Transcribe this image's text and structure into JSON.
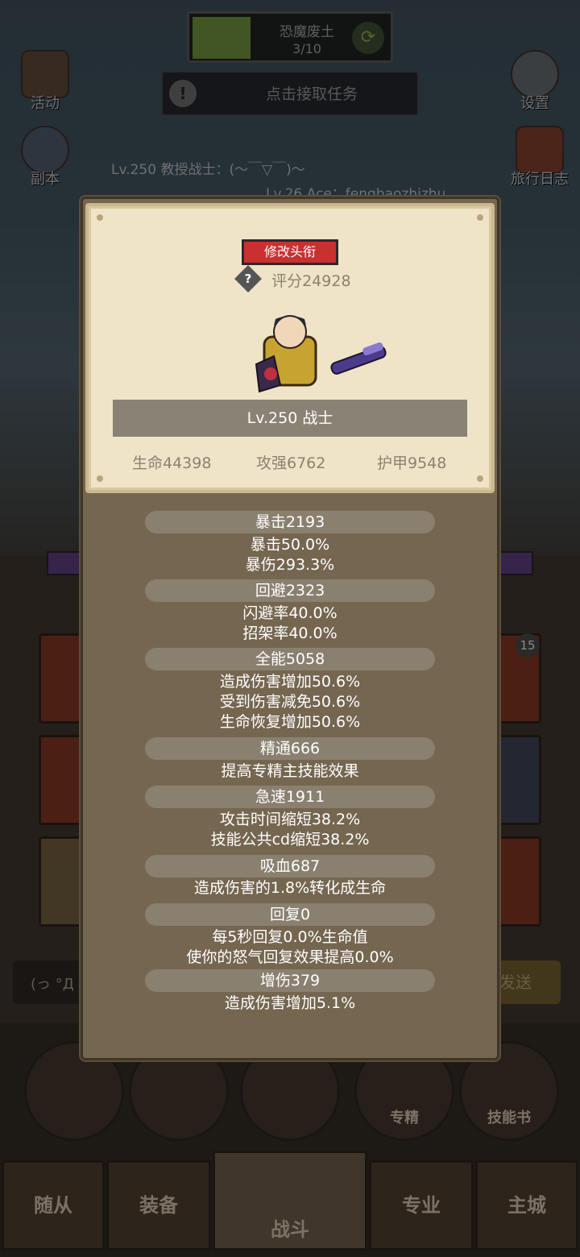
{
  "quest": {
    "name": "恐魔废土",
    "progress": "3/10"
  },
  "task_button": {
    "label": "点击接取任务"
  },
  "side_menu": {
    "activity": "活动",
    "dungeon": "副本",
    "settings": "设置",
    "travel_log": "旅行日志"
  },
  "chat": {
    "line1": "Lv.250 教授战士：(～￣▽￣)～",
    "line2": "Lv.26 Ace：fengbaozhizhu"
  },
  "skill_badge": "15",
  "send": {
    "input_prefix": "(っ °Д °;",
    "button": "发送"
  },
  "round_buttons": {
    "spec": "专精",
    "skill_book": "技能书"
  },
  "bottom_nav": [
    "随从",
    "装备",
    "战斗",
    "专业",
    "主城"
  ],
  "profile": {
    "change_title_button": "修改头衔",
    "score_icon": "?",
    "score": "评分24928",
    "name_bar": "Lv.250 战士",
    "hp": "生命44398",
    "attack": "攻强6762",
    "armor": "护甲9548"
  },
  "stats": [
    {
      "header": "暴击2193",
      "lines": [
        "暴击50.0%",
        "暴伤293.3%"
      ]
    },
    {
      "header": "回避2323",
      "lines": [
        "闪避率40.0%",
        "招架率40.0%"
      ]
    },
    {
      "header": "全能5058",
      "lines": [
        "造成伤害增加50.6%",
        "受到伤害减免50.6%",
        "生命恢复增加50.6%"
      ]
    },
    {
      "header": "精通666",
      "lines": [
        "提高专精主技能效果"
      ]
    },
    {
      "header": "急速1911",
      "lines": [
        "攻击时间缩短38.2%",
        "技能公共cd缩短38.2%"
      ]
    },
    {
      "header": "吸血687",
      "lines": [
        "造成伤害的1.8%转化成生命"
      ]
    },
    {
      "header": "回复0",
      "lines": [
        "每5秒回复0.0%生命值",
        "使你的怒气回复效果提高0.0%"
      ]
    },
    {
      "header": "增伤379",
      "lines": [
        "造成伤害增加5.1%"
      ]
    }
  ],
  "colors": {
    "title_button": "#c93030",
    "panel": "#756650",
    "parchment": "#efe4c7",
    "stat_header": "#8a8070"
  }
}
